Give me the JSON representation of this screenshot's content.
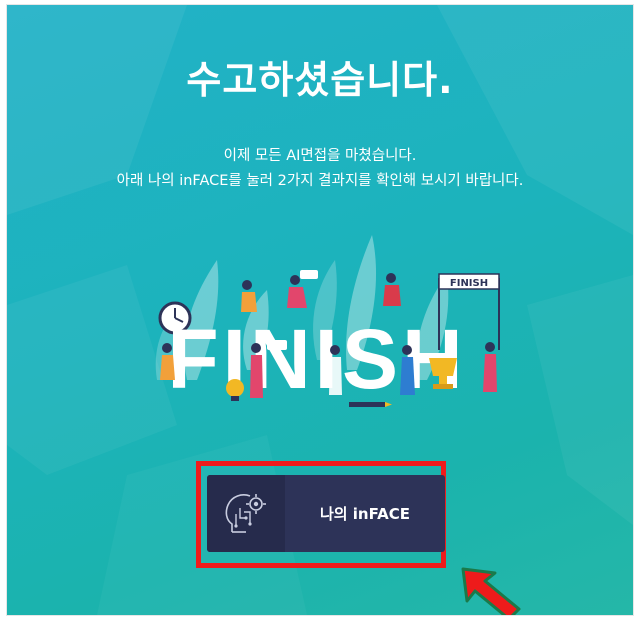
{
  "finish": {
    "title": "수고하셨습니다.",
    "message_line1": "이제 모든 AI면접을 마쳤습니다.",
    "message_line2": "아래 나의 inFACE를 눌러 2가지 결과지를 확인해 보시기 바랍니다.",
    "illustration_word": "FINISH",
    "banner_text": "FINISH",
    "button_label": "나의 inFACE"
  },
  "icons": {
    "button_icon": "ai-head-gear-icon",
    "pointer": "red-arrow-icon"
  },
  "colors": {
    "background": "#1cb3bc",
    "button": "#2d3358",
    "highlight": "#ee1b1b"
  }
}
